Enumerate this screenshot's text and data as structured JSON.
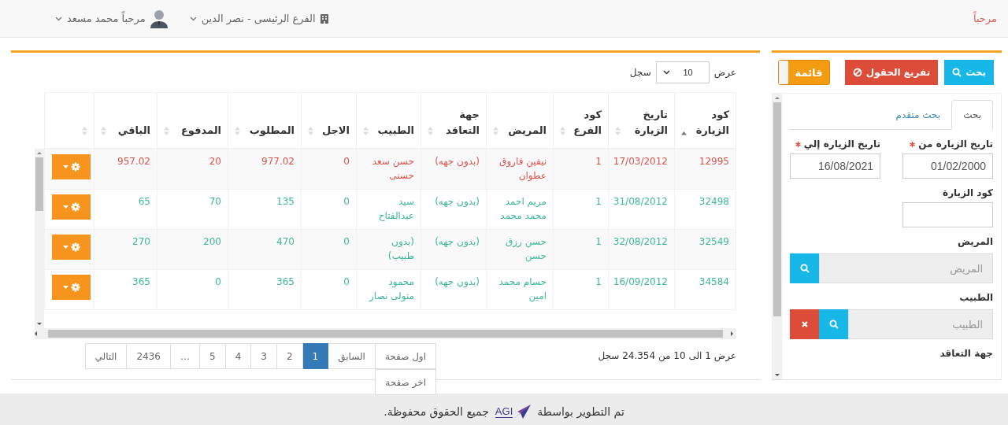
{
  "header": {
    "greeting": "مرحباً",
    "branch": "الفرع الرئيسى - نصر الدين",
    "user": "مرحباً محمد مسعد"
  },
  "search_panel": {
    "buttons": [
      {
        "kind": "search",
        "label": "بحث"
      },
      {
        "kind": "clear",
        "label": "تفريغ الحقول"
      }
    ],
    "list_toggle": {
      "label": "قائمة",
      "on": true
    },
    "tabs": [
      {
        "label": "بحث",
        "selected": true
      },
      {
        "label": "بحث متقدم",
        "selected": false
      }
    ],
    "fields": [
      {
        "kind": "input",
        "label": "تاريخ الزياره من",
        "required": true,
        "value": "01/02/2000"
      },
      {
        "kind": "input",
        "label": "تاريخ الزياره إلي",
        "required": true,
        "value": "16/08/2021"
      },
      {
        "kind": "input",
        "label": "كود الزيارة",
        "required": false
      },
      {
        "kind": "lookup",
        "label": "المريض",
        "placeholder": "المريض",
        "clearable": false
      },
      {
        "kind": "lookup",
        "label": "الطبيب",
        "placeholder": "الطبيب",
        "clearable": true
      },
      {
        "kind": "heading",
        "label": "جهة التعاقد"
      }
    ]
  },
  "table": {
    "length_before": "عرض",
    "page_size": "10",
    "length_after": "سجل",
    "columns": [
      {
        "label": "كود الزيارة",
        "sorted": true
      },
      {
        "label": "تاريخ الزيارة",
        "sorted": false
      },
      {
        "label": "كود الفرع",
        "sorted": false
      },
      {
        "label": "المريض",
        "sorted": false
      },
      {
        "label": "جهة التعاقد",
        "sorted": false
      },
      {
        "label": "الطبيب",
        "sorted": false
      },
      {
        "label": "الاجل",
        "sorted": false
      },
      {
        "label": "المطلوب",
        "sorted": false
      },
      {
        "label": "المدفوع",
        "sorted": false
      },
      {
        "label": "الباقي",
        "sorted": false
      },
      {
        "sorted": false
      }
    ],
    "rows": [
      {
        "color": "#d9534f",
        "cells": [
          "12995",
          "17/03/2012",
          "1",
          "نيفين فاروق عطوان",
          "(بدون جهه)",
          "حسن سعد حسنى",
          "0",
          "977.02",
          "20",
          "957.02"
        ]
      },
      {
        "color": "#3cb79a",
        "cells": [
          "32498",
          "31/08/2012",
          "1",
          "مريم احمد محمد محمد",
          "(بدون جهه)",
          "سيد عبدالفتاح",
          "0",
          "135",
          "70",
          "65"
        ]
      },
      {
        "color": "#3cb79a",
        "cells": [
          "32549",
          "32/08/2012",
          "1",
          "حسن رزق حسن",
          "(بدون جهه)",
          "(بدون طبيب)",
          "0",
          "470",
          "200",
          "270"
        ]
      },
      {
        "color": "#3cb79a",
        "cells": [
          "34584",
          "16/09/2012",
          "1",
          "حسام محمد امين",
          "(بدون جهه)",
          "محمود متولى نصار",
          "0",
          "365",
          "0",
          "365"
        ]
      }
    ],
    "info": "عرض 1 الى 10 من 24.354 سجل",
    "pages": [
      {
        "label": "اول صفحة",
        "selected": false
      },
      {
        "label": "السابق",
        "selected": false
      },
      {
        "label": "1",
        "selected": true
      },
      {
        "label": "2",
        "selected": false
      },
      {
        "label": "3",
        "selected": false
      },
      {
        "label": "4",
        "selected": false
      },
      {
        "label": "5",
        "selected": false
      },
      {
        "label": "…",
        "selected": false
      },
      {
        "label": "2436",
        "selected": false
      },
      {
        "label": "التالي",
        "selected": false
      },
      {
        "label": "اخر صفحة",
        "selected": false
      }
    ]
  },
  "footer": {
    "text_before": "تم التطوير بواسطة",
    "logo": "AGI",
    "text_after": "جميع الحقوق محفوظة."
  }
}
